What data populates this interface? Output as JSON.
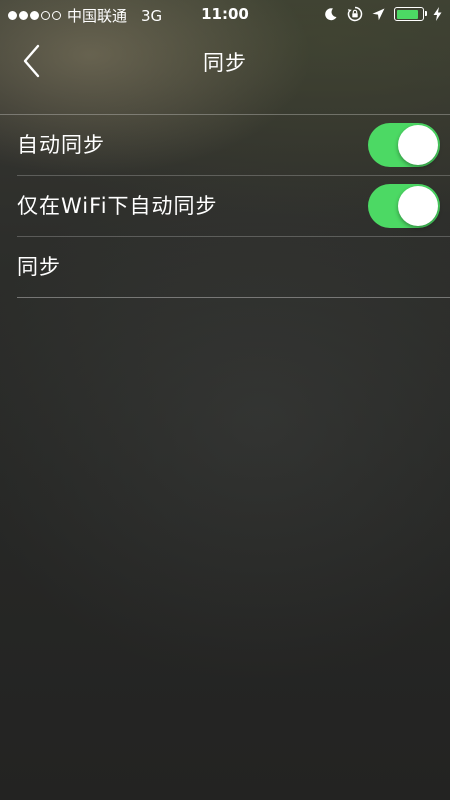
{
  "status_bar": {
    "carrier": "中国联通",
    "network": "3G",
    "time": "11:00",
    "signal_bars_filled": 3,
    "signal_bars_total": 5,
    "battery_level": 0.85,
    "battery_color": "#4cd964",
    "icons": [
      "moon-icon",
      "rotation-lock-icon",
      "location-arrow-icon",
      "battery-icon",
      "charging-bolt-icon"
    ]
  },
  "nav": {
    "title": "同步",
    "back_icon": "chevron-left-icon"
  },
  "settings": {
    "items": [
      {
        "label": "自动同步",
        "toggle": true
      },
      {
        "label": "仅在WiFi下自动同步",
        "toggle": true
      },
      {
        "label": "同步"
      }
    ]
  },
  "colors": {
    "toggle_on": "#4cd964",
    "text": "#ffffff"
  }
}
